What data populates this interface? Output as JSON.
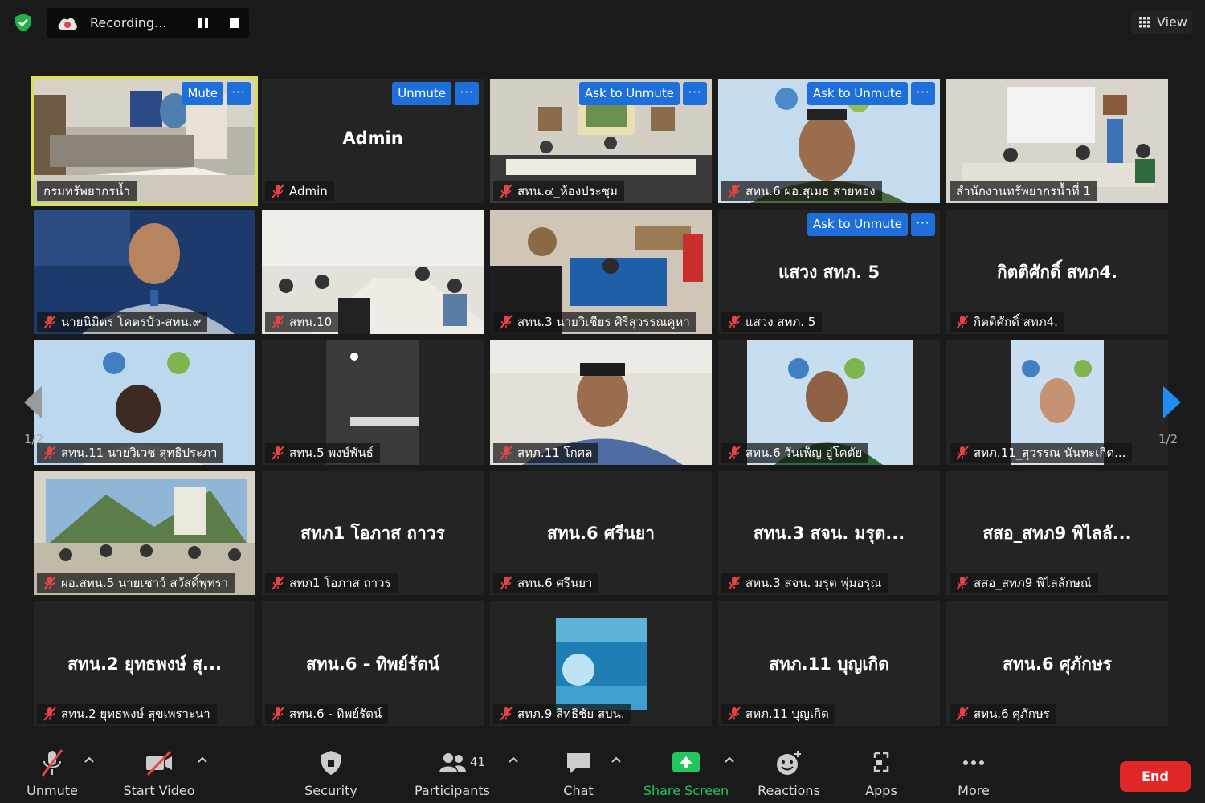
{
  "recording": {
    "label": "Recording..."
  },
  "view": {
    "label": "View"
  },
  "pager": {
    "left": "1/2",
    "right": "1/2"
  },
  "tiles": [
    {
      "label": "กรมทรัพยากรน้ำ",
      "controls": [
        "Mute",
        "···"
      ]
    },
    {
      "name": "Admin",
      "label": "Admin",
      "controls": [
        "Unmute",
        "···"
      ]
    },
    {
      "label": "สทน.๔_ห้องประชุม",
      "controls": [
        "Ask to Unmute",
        "···"
      ]
    },
    {
      "label": "สทน.6 ผอ.สุเมธ สายทอง",
      "controls": [
        "Ask to Unmute",
        "···"
      ]
    },
    {
      "label": "สำนักงานทรัพยากรน้ำที่ 1"
    },
    {
      "label": "นายนิมิตร โคตรบัว-สทน.๙"
    },
    {
      "label": "สทน.10"
    },
    {
      "label": "สทน.3 นายวิเชียร ศิริสุวรรณคูหา"
    },
    {
      "name": "แสวง สทภ. 5",
      "label": "แสวง สทภ. 5",
      "controls": [
        "Ask to Unmute",
        "···"
      ]
    },
    {
      "name": "กิตติศักดิ์ สทภ4.",
      "label": "กิตติศักดิ์ สทภ4."
    },
    {
      "label": "สทน.11 นายวิเวช สุทธิประภา"
    },
    {
      "label": "สทน.5 พงษ์พันธ์"
    },
    {
      "label": "สทภ.11 โกศล"
    },
    {
      "label": "สทน.6 วันเพ็ญ อู่โคตัย"
    },
    {
      "label": "สทภ.11_สุวรรณ นันทะเกิด..."
    },
    {
      "label": "ผอ.สทน.5 นายเชาว์ สวัสดิ์พุทรา"
    },
    {
      "name": "สทภ1 โอภาส ถาวร",
      "label": "สทภ1 โอภาส ถาวร"
    },
    {
      "name": "สทน.6 ศรีนยา",
      "label": "สทน.6 ศรีนยา"
    },
    {
      "name": "สทน.3 สจน. มรุต...",
      "label": "สทน.3 สจน. มรุต พุ่มอรุณ"
    },
    {
      "name": "สสอ_สทภ9 พิไลลั...",
      "label": "สสอ_สทภ9 พิไลลักษณ์"
    },
    {
      "name": "สทน.2 ยุทธพงษ์ สุ...",
      "label": "สทน.2 ยุทธพงษ์ สุขเพราะนา"
    },
    {
      "name": "สทน.6 - ทิพย์รัตน์",
      "label": "สทน.6 - ทิพย์รัตน์"
    },
    {
      "label": "สทภ.9 สิทธิชัย สบน."
    },
    {
      "name": "สทภ.11 บุญเกิด",
      "label": "สทภ.11 บุญเกิด"
    },
    {
      "name": "สทน.6 ศุภักษร",
      "label": "สทน.6 ศุภักษร"
    }
  ],
  "toolbar": {
    "unmute": "Unmute",
    "start_video": "Start Video",
    "security": "Security",
    "participants": "Participants",
    "participants_count": "41",
    "chat": "Chat",
    "share_screen": "Share Screen",
    "reactions": "Reactions",
    "apps": "Apps",
    "more": "More",
    "end": "End"
  },
  "colors": {
    "accent": "#1e6fd9",
    "active_speaker": "#d8df54",
    "share_green": "#22c55e",
    "end_red": "#e02828",
    "mute_red": "#e84343"
  }
}
